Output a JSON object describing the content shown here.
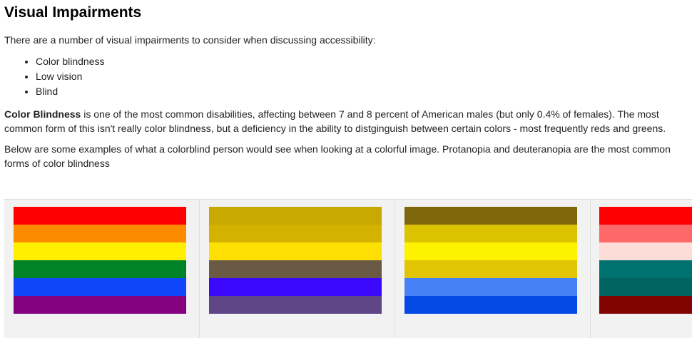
{
  "heading": "Visual Impairments",
  "intro": "There are a number of visual impairments to consider when discussing accessibility:",
  "list_items": [
    "Color blindness",
    "Low vision",
    "Blind"
  ],
  "color_blindness_paragraph": {
    "bold": "Color Blindness",
    "rest": " is one of the most common disabilities, affecting between 7 and 8 percent of American males (but only 0.4% of females).  The most common form of this isn't really color blindness, but a deficiency in the ability to distginguish between certain colors - most frequently reds and greens."
  },
  "examples_paragraph": "Below are some examples of what a colorblind person would see when looking at a colorful image.  Protanopia and deuteranopia are the most common forms of color blindness",
  "flags": [
    [
      "#fe0000",
      "#fe8a00",
      "#ffef00",
      "#008226",
      "#0f46fa",
      "#85007e"
    ],
    [
      "#c7a901",
      "#d4b300",
      "#fde001",
      "#6a5a45",
      "#3a08fa",
      "#5e4687"
    ],
    [
      "#7e670b",
      "#dcc300",
      "#fdf300",
      "#e1c404",
      "#4781f8",
      "#0549e6"
    ],
    [
      "#ff0000",
      "#fd6868",
      "#fedcd8",
      "#007370",
      "#016461",
      "#820402"
    ]
  ]
}
